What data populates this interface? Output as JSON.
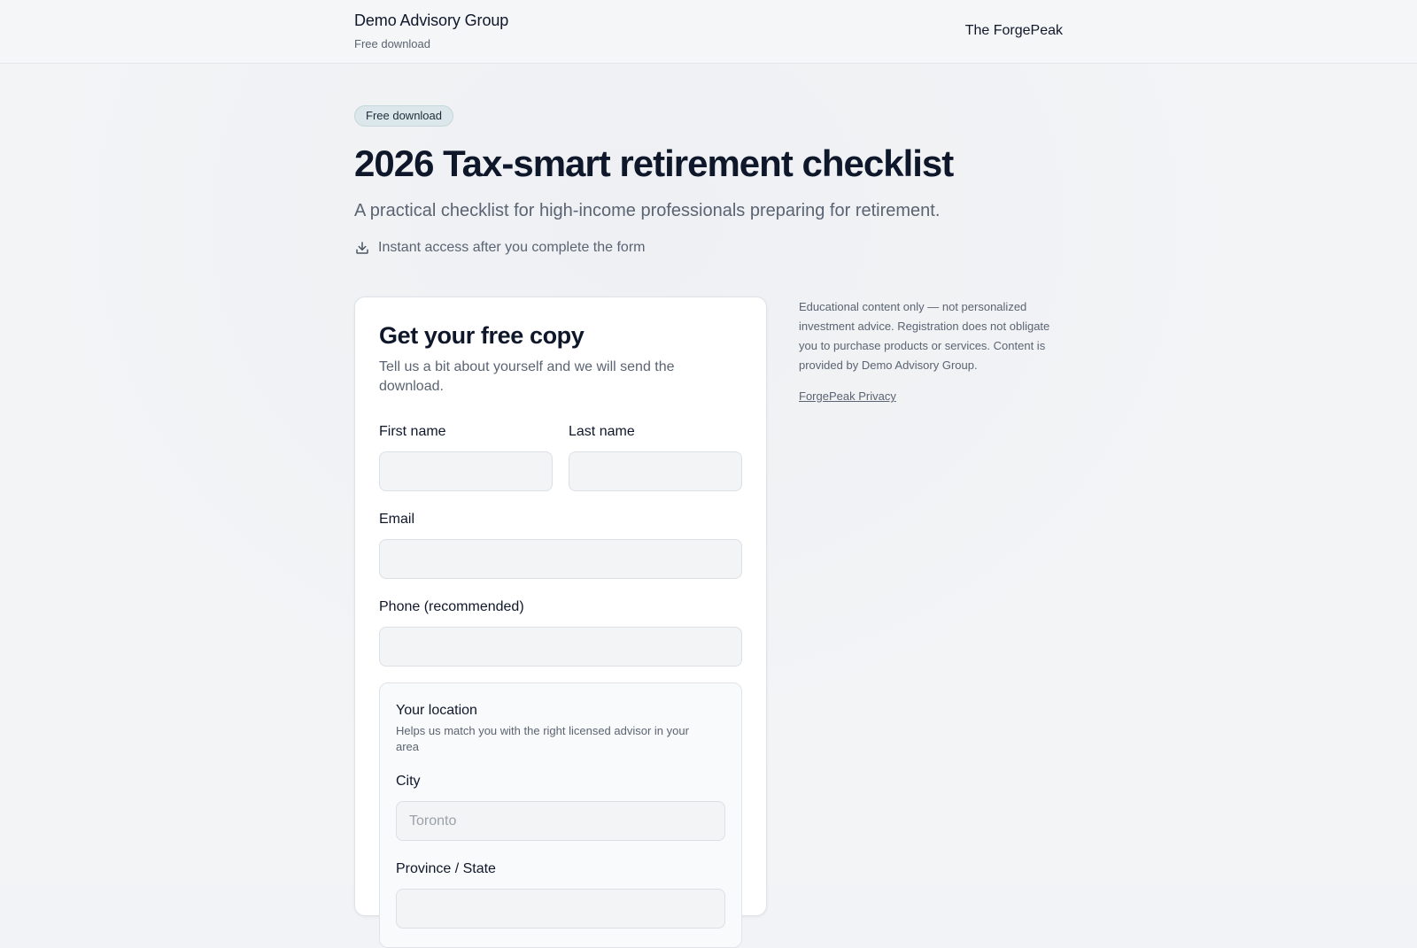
{
  "header": {
    "brand_name": "Demo Advisory Group",
    "brand_sub": "Free download",
    "partner": "The ForgePeak"
  },
  "hero": {
    "badge": "Free download",
    "title": "2026 Tax-smart retirement checklist",
    "subtitle": "A practical checklist for high-income professionals preparing for retirement.",
    "access_note": "Instant access after you complete the form",
    "access_icon": "download-icon"
  },
  "form": {
    "title": "Get your free copy",
    "description": "Tell us a bit about yourself and we will send the download.",
    "first_name": {
      "label": "First name",
      "value": "",
      "placeholder": ""
    },
    "last_name": {
      "label": "Last name",
      "value": "",
      "placeholder": ""
    },
    "email": {
      "label": "Email",
      "value": "",
      "placeholder": ""
    },
    "phone": {
      "label": "Phone (recommended)",
      "value": "",
      "placeholder": ""
    },
    "location": {
      "title": "Your location",
      "description": "Helps us match you with the right licensed advisor in your area",
      "city": {
        "label": "City",
        "value": "",
        "placeholder": "Toronto"
      },
      "province": {
        "label": "Province / State",
        "value": "",
        "placeholder": ""
      }
    }
  },
  "sidebar": {
    "disclaimer": "Educational content only — not personalized investment advice. Registration does not obligate you to purchase products or services. Content is provided by Demo Advisory Group.",
    "privacy_link": "ForgePeak Privacy"
  },
  "colors": {
    "text_primary": "#0f172a",
    "text_muted": "#5b6472",
    "badge_bg": "#dbe7ea",
    "input_bg": "#f3f4f6",
    "page_bg": "#f1f3f6"
  }
}
